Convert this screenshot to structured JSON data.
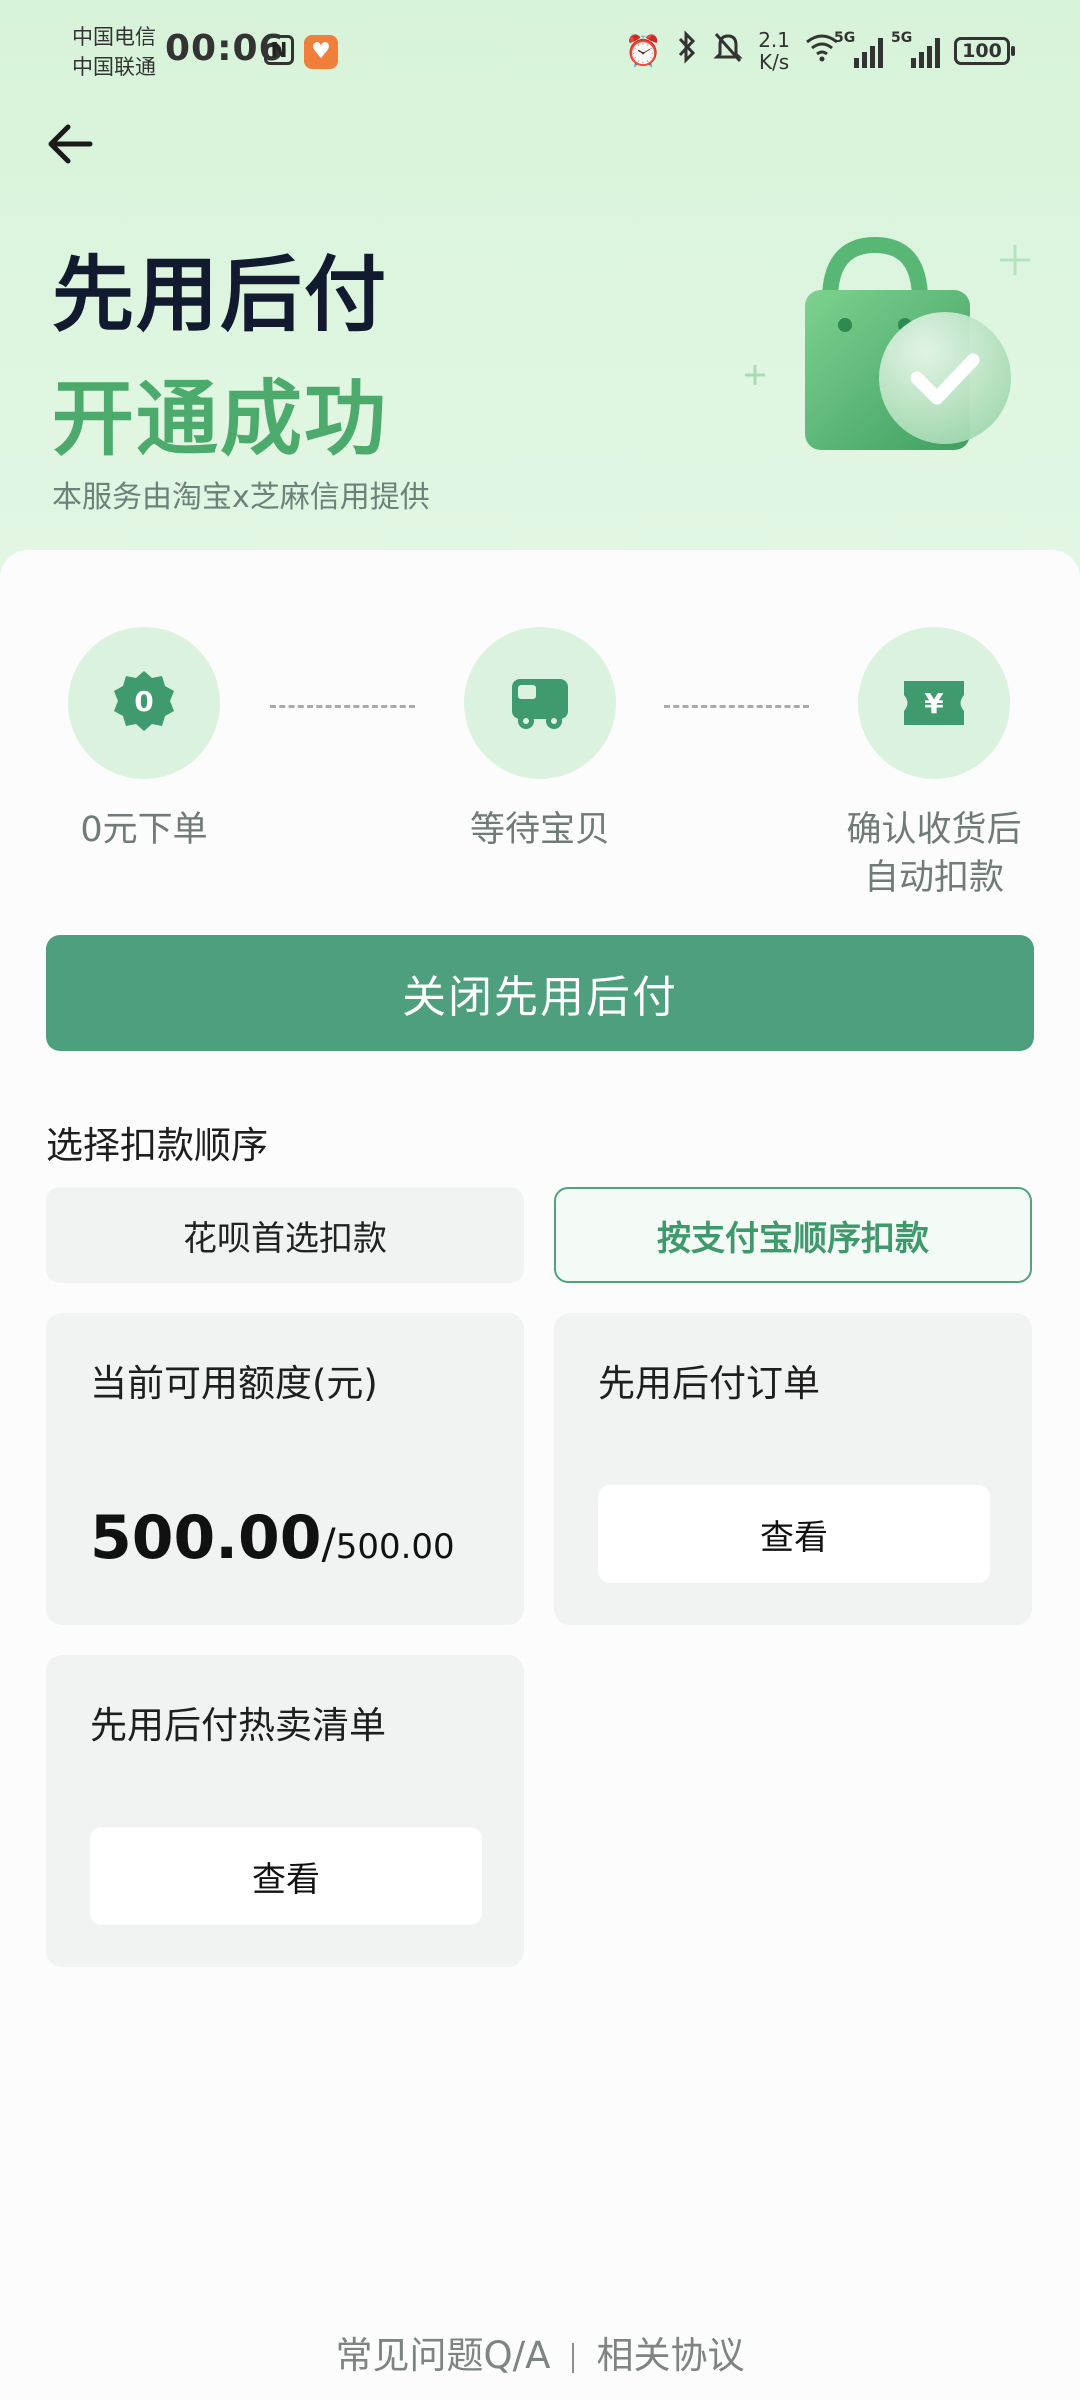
{
  "status_bar": {
    "carrier1": "中国电信",
    "carrier2": "中国联通",
    "time": "00:06",
    "nfc": "N",
    "speed_value": "2.1",
    "speed_unit": "K/s",
    "network1": "5G",
    "network2": "5G",
    "battery": "100"
  },
  "header": {
    "title_line1": "先用后付",
    "title_line2": "开通成功",
    "provider_text": "本服务由淘宝x芝麻信用提供"
  },
  "steps": [
    {
      "badge": "0",
      "label": "0元下单"
    },
    {
      "label": "等待宝贝"
    },
    {
      "badge": "¥",
      "label_line1": "确认收货后",
      "label_line2": "自动扣款"
    }
  ],
  "close_button": "关闭先用后付",
  "deduction": {
    "section_title": "选择扣款顺序",
    "options": [
      "花呗首选扣款",
      "按支付宝顺序扣款"
    ],
    "selected_index": 1
  },
  "panels": {
    "credit": {
      "title": "当前可用额度(元)",
      "available": "500.00",
      "separator": "/",
      "total": "500.00"
    },
    "orders": {
      "title": "先用后付订单",
      "button": "查看"
    },
    "hot_list": {
      "title": "先用后付热卖清单",
      "button": "查看"
    }
  },
  "footer": {
    "faq": "常见问题Q/A",
    "agreement": "相关协议"
  },
  "colors": {
    "brand_green": "#4caa6c",
    "button_green": "#4d9f7d",
    "hero_bg": "#d7f3d9"
  }
}
